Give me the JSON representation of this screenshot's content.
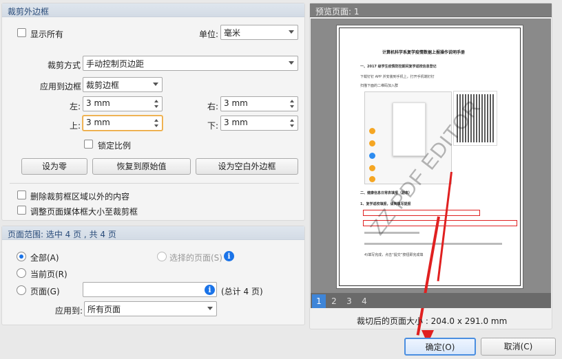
{
  "crop_margins": {
    "title": "裁剪外边框",
    "show_all_label": "显示所有",
    "unit_label": "单位:",
    "unit_value": "毫米",
    "crop_mode_label": "裁剪方式",
    "crop_mode_value": "手动控制页边距",
    "apply_to_box_label": "应用到边框",
    "apply_to_box_value": "裁剪边框",
    "left_label": "左:",
    "left_value": "3 mm",
    "right_label": "右:",
    "right_value": "3 mm",
    "top_label": "上:",
    "top_value": "3 mm",
    "bottom_label": "下:",
    "bottom_value": "3 mm",
    "lock_ratio_label": "锁定比例",
    "set_zero_button": "设为零",
    "restore_button": "恢复到原始值",
    "set_white_margin_button": "设为空白外边框",
    "delete_outside_label": "删除裁剪框区域以外的内容",
    "resize_media_label": "调整页面媒体框大小至裁剪框"
  },
  "page_range": {
    "title": "页面范围: 选中 4 页 , 共 4 页",
    "all_label": "全部(A)",
    "selected_pages_label": "选择的页面(S)",
    "current_page_label": "当前页(R)",
    "pages_label": "页面(G)",
    "pages_value": "",
    "total_label": "(总计 4 页)",
    "apply_to_label": "应用到:",
    "apply_to_value": "所有页面"
  },
  "preview": {
    "title": "预览页面: 1",
    "page_tabs": [
      "1",
      "2",
      "3",
      "4"
    ],
    "size_label": "裁切后的页面大小 : 204.0 x 291.0 mm",
    "doc_title": "计算机科学系复学疫情数据上报操作说明手册",
    "doc_heading1": "一、2017 级学生疫情防控期间复学返校信息登记",
    "doc_line1": "下载钉钉 APP 并安装到手机上，打开手机端钉钉",
    "doc_line2": "扫描下面的二维码加入群",
    "doc_heading2": "二、健康信息日常表填报（副表）",
    "doc_heading3": "1、复学返校填报，请到填写提报",
    "doc_line3": "4)填写完成，点击“提交”按钮即完成填",
    "watermark": "ZZ PDF EDITOR"
  },
  "footer": {
    "ok_button": "确定(O)",
    "cancel_button": "取消(C)"
  },
  "colors": {
    "accent": "#1a73e8",
    "annotation_red": "#e02020"
  }
}
